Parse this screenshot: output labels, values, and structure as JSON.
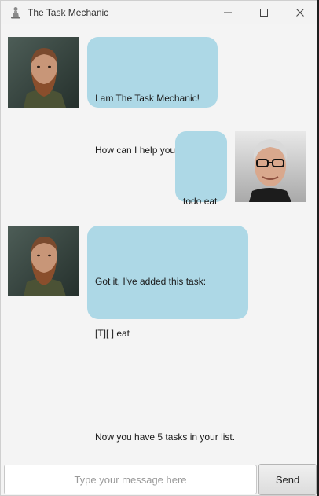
{
  "window": {
    "title": "The Task Mechanic",
    "controls": [
      "minimize-icon",
      "maximize-icon",
      "close-icon"
    ]
  },
  "colors": {
    "bubble": "#add8e6",
    "background": "#f4f4f4"
  },
  "messages": [
    {
      "sender": "bot",
      "avatar": "bot-avatar-bearded-man",
      "lines": [
        "I am The Task Mechanic!",
        "How can I help you today?"
      ]
    },
    {
      "sender": "user",
      "avatar": "user-avatar-man-with-glasses",
      "lines": [
        "todo eat"
      ]
    },
    {
      "sender": "bot",
      "avatar": "bot-avatar-bearded-man",
      "lines": [
        "Got it, I've added this task:",
        "[T][ ] eat",
        "",
        "Now you have 5 tasks in your list."
      ]
    }
  ],
  "input": {
    "placeholder": "Type your message here",
    "value": ""
  },
  "send_label": "Send"
}
